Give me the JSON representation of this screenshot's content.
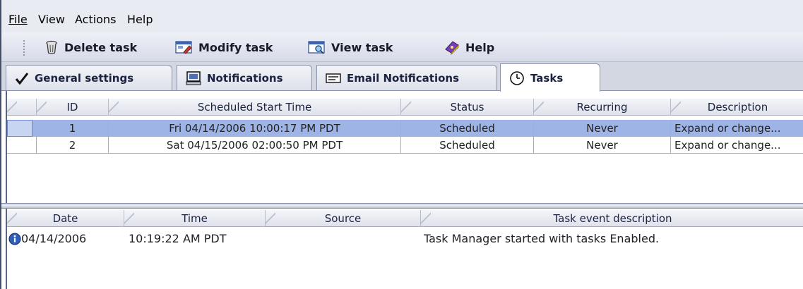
{
  "menu": {
    "items": [
      "File",
      "View",
      "Actions",
      "Help"
    ]
  },
  "toolbar": {
    "delete_label": "Delete task",
    "modify_label": "Modify task",
    "view_label": "View task",
    "help_label": "Help"
  },
  "tabs": [
    {
      "label": "General settings",
      "icon": "checkmark-icon",
      "active": false
    },
    {
      "label": "Notifications",
      "icon": "monitor-icon",
      "active": false
    },
    {
      "label": "Email Notifications",
      "icon": "envelope-icon",
      "active": false
    },
    {
      "label": "Tasks",
      "icon": "clock-icon",
      "active": true
    }
  ],
  "tasks_table": {
    "columns": [
      "ID",
      "Scheduled Start Time",
      "Status",
      "Recurring",
      "Description"
    ],
    "rows": [
      {
        "id": "1",
        "start": "Fri 04/14/2006 10:00:17 PM PDT",
        "status": "Scheduled",
        "recurring": "Never",
        "description": "Expand or change...",
        "selected": true
      },
      {
        "id": "2",
        "start": "Sat 04/15/2006 02:00:50 PM PDT",
        "status": "Scheduled",
        "recurring": "Never",
        "description": "Expand or change...",
        "selected": false
      }
    ]
  },
  "events_table": {
    "columns": [
      "Date",
      "Time",
      "Source",
      "Task event description"
    ],
    "rows": [
      {
        "icon": "info-icon",
        "date": "04/14/2006",
        "time": "10:19:22 AM PDT",
        "source": "",
        "description": "Task Manager started with tasks Enabled."
      }
    ]
  },
  "colors": {
    "selection": "#9fb4e6",
    "header": "#dfe2eb",
    "toolbar": "#d7dbe8"
  }
}
